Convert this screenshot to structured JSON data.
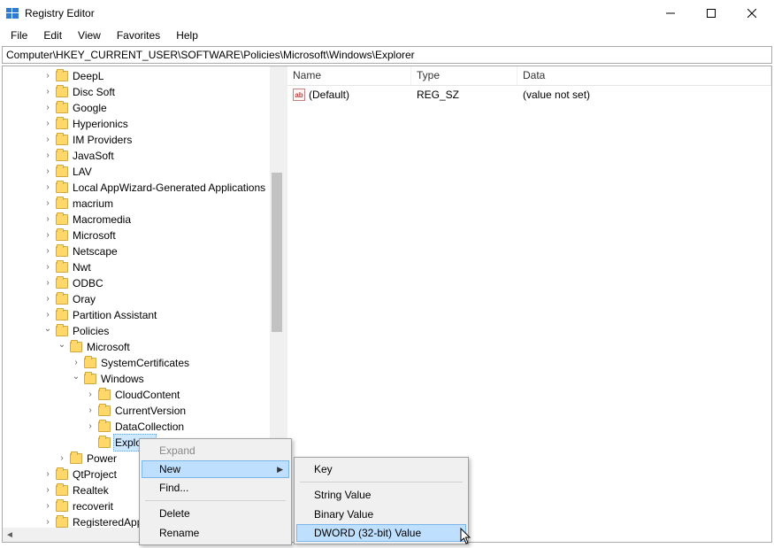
{
  "window": {
    "title": "Registry Editor"
  },
  "menu": {
    "file": "File",
    "edit": "Edit",
    "view": "View",
    "favorites": "Favorites",
    "help": "Help"
  },
  "address": "Computer\\HKEY_CURRENT_USER\\SOFTWARE\\Policies\\Microsoft\\Windows\\Explorer",
  "list": {
    "headers": {
      "name": "Name",
      "type": "Type",
      "data": "Data"
    },
    "rows": [
      {
        "name": "(Default)",
        "type": "REG_SZ",
        "data": "(value not set)"
      }
    ]
  },
  "tree": {
    "items": [
      {
        "depth": 2,
        "exp": ">",
        "label": "DeepL"
      },
      {
        "depth": 2,
        "exp": ">",
        "label": "Disc Soft"
      },
      {
        "depth": 2,
        "exp": ">",
        "label": "Google"
      },
      {
        "depth": 2,
        "exp": ">",
        "label": "Hyperionics"
      },
      {
        "depth": 2,
        "exp": ">",
        "label": "IM Providers"
      },
      {
        "depth": 2,
        "exp": ">",
        "label": "JavaSoft"
      },
      {
        "depth": 2,
        "exp": ">",
        "label": "LAV"
      },
      {
        "depth": 2,
        "exp": ">",
        "label": "Local AppWizard-Generated Applications"
      },
      {
        "depth": 2,
        "exp": ">",
        "label": "macrium"
      },
      {
        "depth": 2,
        "exp": ">",
        "label": "Macromedia"
      },
      {
        "depth": 2,
        "exp": ">",
        "label": "Microsoft"
      },
      {
        "depth": 2,
        "exp": ">",
        "label": "Netscape"
      },
      {
        "depth": 2,
        "exp": ">",
        "label": "Nwt"
      },
      {
        "depth": 2,
        "exp": ">",
        "label": "ODBC"
      },
      {
        "depth": 2,
        "exp": ">",
        "label": "Oray"
      },
      {
        "depth": 2,
        "exp": ">",
        "label": "Partition Assistant"
      },
      {
        "depth": 2,
        "exp": "v",
        "label": "Policies"
      },
      {
        "depth": 3,
        "exp": "v",
        "label": "Microsoft"
      },
      {
        "depth": 4,
        "exp": ">",
        "label": "SystemCertificates"
      },
      {
        "depth": 4,
        "exp": "v",
        "label": "Windows"
      },
      {
        "depth": 5,
        "exp": ">",
        "label": "CloudContent"
      },
      {
        "depth": 5,
        "exp": ">",
        "label": "CurrentVersion"
      },
      {
        "depth": 5,
        "exp": ">",
        "label": "DataCollection"
      },
      {
        "depth": 5,
        "exp": "",
        "label": "Explorer",
        "selected": true
      },
      {
        "depth": 3,
        "exp": ">",
        "label": "Power"
      },
      {
        "depth": 2,
        "exp": ">",
        "label": "QtProject"
      },
      {
        "depth": 2,
        "exp": ">",
        "label": "Realtek"
      },
      {
        "depth": 2,
        "exp": ">",
        "label": "recoverit"
      },
      {
        "depth": 2,
        "exp": ">",
        "label": "RegisteredApplications"
      }
    ]
  },
  "context_menu": {
    "expand": "Expand",
    "new": "New",
    "find": "Find...",
    "delete": "Delete",
    "rename": "Rename"
  },
  "submenu": {
    "key": "Key",
    "string": "String Value",
    "binary": "Binary Value",
    "dword": "DWORD (32-bit) Value"
  }
}
